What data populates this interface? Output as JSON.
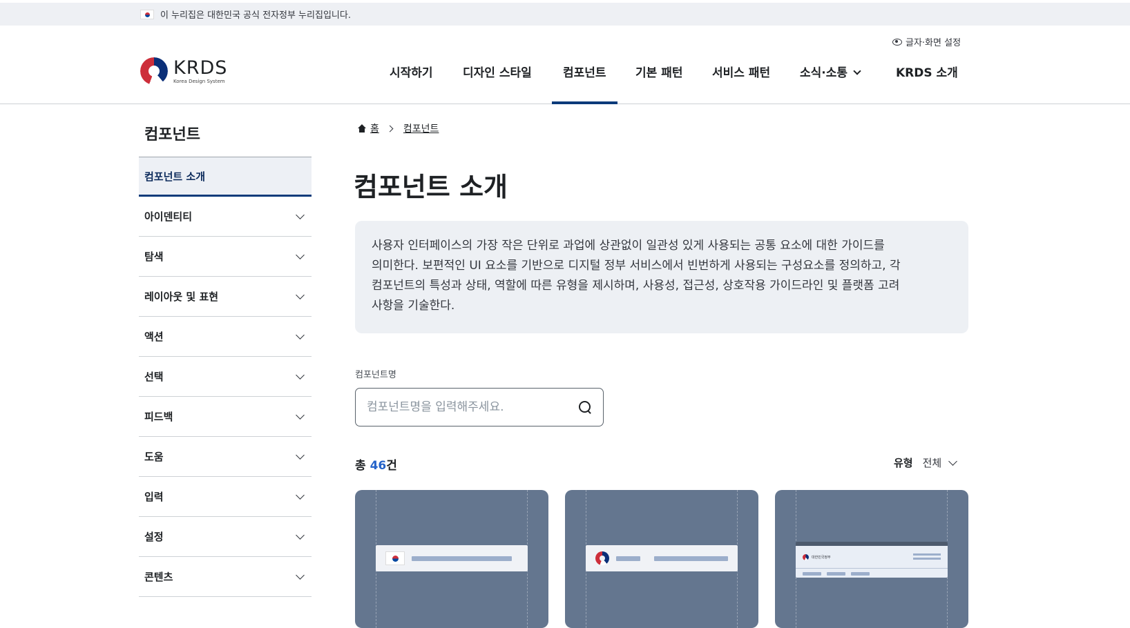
{
  "gov_banner": {
    "text": "이 누리집은 대한민국 공식 전자정부 누리집입니다."
  },
  "header": {
    "logo_title": "KRDS",
    "logo_sub": "Korea Design System",
    "text_setting": "글자·화면 설정",
    "nav": [
      {
        "label": "시작하기"
      },
      {
        "label": "디자인 스타일"
      },
      {
        "label": "컴포넌트",
        "active": true
      },
      {
        "label": "기본 패턴"
      },
      {
        "label": "서비스 패턴"
      },
      {
        "label": "소식·소통",
        "dropdown": true
      },
      {
        "label": "KRDS 소개"
      }
    ]
  },
  "sidebar": {
    "title": "컴포넌트",
    "items": [
      {
        "label": "컴포넌트 소개",
        "active": true
      },
      {
        "label": "아이덴티티"
      },
      {
        "label": "탐색"
      },
      {
        "label": "레이아웃 및 표현"
      },
      {
        "label": "액션"
      },
      {
        "label": "선택"
      },
      {
        "label": "피드백"
      },
      {
        "label": "도움"
      },
      {
        "label": "입력"
      },
      {
        "label": "설정"
      },
      {
        "label": "콘텐츠"
      }
    ]
  },
  "breadcrumb": {
    "home": "홈",
    "current": "컴포넌트"
  },
  "main": {
    "title": "컴포넌트 소개",
    "intro_lines": [
      "사용자 인터페이스의 가장 작은 단위로 과업에 상관없이 일관성 있게 사용되는 공통 요소에 대한 가이드를",
      "의미한다. 보편적인 UI 요소를 기반으로 디지털 정부 서비스에서 빈번하게 사용되는 구성요소를 정의하고, 각",
      "컴포넌트의 특성과 상태, 역할에 따른 유형을 제시하며, 사용성, 접근성, 상호작용 가이드라인 및 플랫폼 고려",
      "사항을 기술한다."
    ],
    "search": {
      "label": "컴포넌트명",
      "placeholder": "컴포넌트명을 입력해주세요.",
      "value": ""
    },
    "count_prefix": "총 ",
    "count_num": "46",
    "count_suffix": "건",
    "filter_label": "유형",
    "filter_value": "전체",
    "card3_gov_text": "대한민국정부"
  },
  "colors": {
    "accent": "#0b3b7a",
    "count_blue": "#2563c9",
    "card_bg": "#64768f",
    "banner_bg": "#eef0f4",
    "intro_bg": "#edf0f4"
  }
}
